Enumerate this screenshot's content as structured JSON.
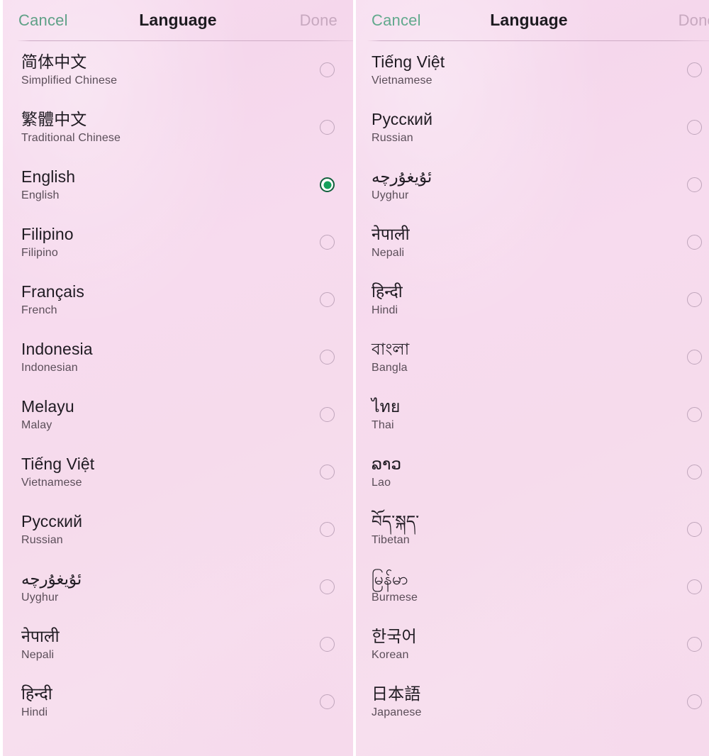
{
  "screens": [
    {
      "name": "left-screen",
      "header": {
        "cancel_label": "Cancel",
        "title": "Language",
        "done_label": "Done"
      },
      "items": [
        {
          "native": "简体中文",
          "english": "Simplified Chinese",
          "selected": false,
          "rtl": false
        },
        {
          "native": "繁體中文",
          "english": "Traditional Chinese",
          "selected": false,
          "rtl": false
        },
        {
          "native": "English",
          "english": "English",
          "selected": true,
          "rtl": false
        },
        {
          "native": "Filipino",
          "english": "Filipino",
          "selected": false,
          "rtl": false
        },
        {
          "native": "Français",
          "english": "French",
          "selected": false,
          "rtl": false
        },
        {
          "native": "Indonesia",
          "english": "Indonesian",
          "selected": false,
          "rtl": false
        },
        {
          "native": "Melayu",
          "english": "Malay",
          "selected": false,
          "rtl": false
        },
        {
          "native": "Tiếng Việt",
          "english": "Vietnamese",
          "selected": false,
          "rtl": false
        },
        {
          "native": "Русский",
          "english": "Russian",
          "selected": false,
          "rtl": false
        },
        {
          "native": "ئۇيغۇرچە",
          "english": "Uyghur",
          "selected": false,
          "rtl": true
        },
        {
          "native": "नेपाली",
          "english": "Nepali",
          "selected": false,
          "rtl": false
        },
        {
          "native": "हिन्दी",
          "english": "Hindi",
          "selected": false,
          "rtl": false
        }
      ]
    },
    {
      "name": "right-screen",
      "header": {
        "cancel_label": "Cancel",
        "title": "Language",
        "done_label": "Done"
      },
      "items": [
        {
          "native": "Tiếng Việt",
          "english": "Vietnamese",
          "selected": false,
          "rtl": false
        },
        {
          "native": "Русский",
          "english": "Russian",
          "selected": false,
          "rtl": false
        },
        {
          "native": "ئۇيغۇرچە",
          "english": "Uyghur",
          "selected": false,
          "rtl": true
        },
        {
          "native": "नेपाली",
          "english": "Nepali",
          "selected": false,
          "rtl": false
        },
        {
          "native": "हिन्दी",
          "english": "Hindi",
          "selected": false,
          "rtl": false
        },
        {
          "native": "বাংলা",
          "english": "Bangla",
          "selected": false,
          "rtl": false
        },
        {
          "native": "ไทย",
          "english": "Thai",
          "selected": false,
          "rtl": false
        },
        {
          "native": "ລາວ",
          "english": "Lao",
          "selected": false,
          "rtl": false
        },
        {
          "native": "བོད་སྐད་",
          "english": "Tibetan",
          "selected": false,
          "rtl": false
        },
        {
          "native": "မြန်မာ",
          "english": "Burmese",
          "selected": false,
          "rtl": false
        },
        {
          "native": "한국어",
          "english": "Korean",
          "selected": false,
          "rtl": false
        },
        {
          "native": "日本語",
          "english": "Japanese",
          "selected": false,
          "rtl": false
        }
      ]
    }
  ],
  "colors": {
    "background_pink": "#f6dcec",
    "cancel_green": "#5fa087",
    "done_disabled": "#c7a8bf",
    "title_text": "#1d1b20",
    "native_text": "#1f1b22",
    "english_text": "#5b4e59",
    "radio_unselected_border": "#bfa5bb",
    "radio_selected_ring": "#12603c",
    "radio_selected_dot": "#15a05b",
    "divider": "#c4a0bc"
  },
  "icons": {
    "radio_unselected": "radio-unselected-icon",
    "radio_selected": "radio-selected-icon"
  }
}
